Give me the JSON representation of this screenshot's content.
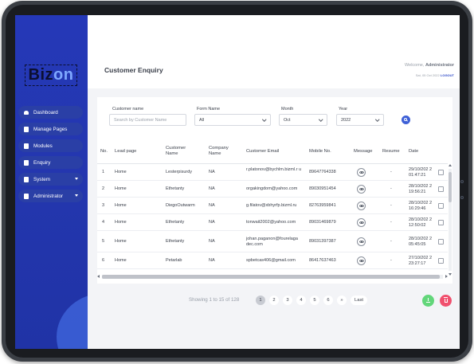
{
  "sidebar": {
    "logo": {
      "part1": "Biz",
      "part2": "on"
    },
    "items": [
      {
        "label": "Dashboard",
        "icon": "dashboard-icon"
      },
      {
        "label": "Manage Pages",
        "icon": "document-icon"
      },
      {
        "label": "Modules",
        "icon": "document-icon"
      },
      {
        "label": "Enquiry",
        "icon": "document-icon"
      },
      {
        "label": "System",
        "icon": "document-icon",
        "has_submenu": true
      },
      {
        "label": "Administrator",
        "icon": "document-icon",
        "has_submenu": true
      }
    ]
  },
  "header": {
    "title": "Customer Enquiry",
    "welcome_prefix": "Welcome, ",
    "user": "Administrator",
    "date": "Sat, 05 Oct 2022",
    "logout": "LOGOUT"
  },
  "filters": {
    "customer_name": {
      "label": "Customer name",
      "placeholder": "Search by Customer Name"
    },
    "form_name": {
      "label": "Form Name",
      "value": "All"
    },
    "month": {
      "label": "Month",
      "value": "Oct"
    },
    "year": {
      "label": "Year",
      "value": "2022"
    }
  },
  "table": {
    "columns": [
      "No.",
      "Lead page",
      "Customer Name",
      "Company Name",
      "Customer Email",
      "Mobile No.",
      "Message",
      "Resume",
      "Date"
    ],
    "rows": [
      {
        "no": "1",
        "lead": "Home",
        "name": "Lesterpisurdy",
        "company": "NA",
        "email": "r.platonov@bychlm.bizml.r u",
        "mobile": "89647764338",
        "resume": "-",
        "date": "29/10/202 2 01:47:21"
      },
      {
        "no": "2",
        "lead": "Home",
        "name": "Ethetanty",
        "company": "NA",
        "email": "orgakingdom@yahoo.com",
        "mobile": "89030951454",
        "resume": "-",
        "date": "28/10/202 2 19:56:21"
      },
      {
        "no": "3",
        "lead": "Home",
        "name": "DiegoOutwarm",
        "company": "NA",
        "email": "g.filatov@xbhyrfp.bizml.ru",
        "mobile": "82763959841",
        "resume": "-",
        "date": "28/10/202 2 16:29:46"
      },
      {
        "no": "4",
        "lead": "Home",
        "name": "Ethetanty",
        "company": "NA",
        "email": "tonwait2002@yahoo.com",
        "mobile": "89031469879",
        "resume": "-",
        "date": "28/10/202 2 12:50:02"
      },
      {
        "no": "5",
        "lead": "Home",
        "name": "Ethetanty",
        "company": "NA",
        "email": "johan.paganon@fourelaga dec.com",
        "mobile": "89031397387",
        "resume": "-",
        "date": "28/10/202 2 05:45:05"
      },
      {
        "no": "6",
        "lead": "Home",
        "name": "Petarlab",
        "company": "NA",
        "email": "spbetcas406@gmail.com",
        "mobile": "86417637463",
        "resume": "-",
        "date": "27/10/202 2 23:27:17"
      }
    ]
  },
  "pagination": {
    "info": "Showing 1 to 15 of 128",
    "pages": [
      "1",
      "2",
      "3",
      "4",
      "5",
      "6",
      "»"
    ],
    "active": "1",
    "last": "Last"
  },
  "actions": {
    "download_icon": "download-icon",
    "delete_icon": "trash-icon",
    "download_color": "#62d67a",
    "delete_color": "#f0506e"
  },
  "colors": {
    "sidebar": "#2538b8",
    "accent": "#3d5fd6"
  }
}
